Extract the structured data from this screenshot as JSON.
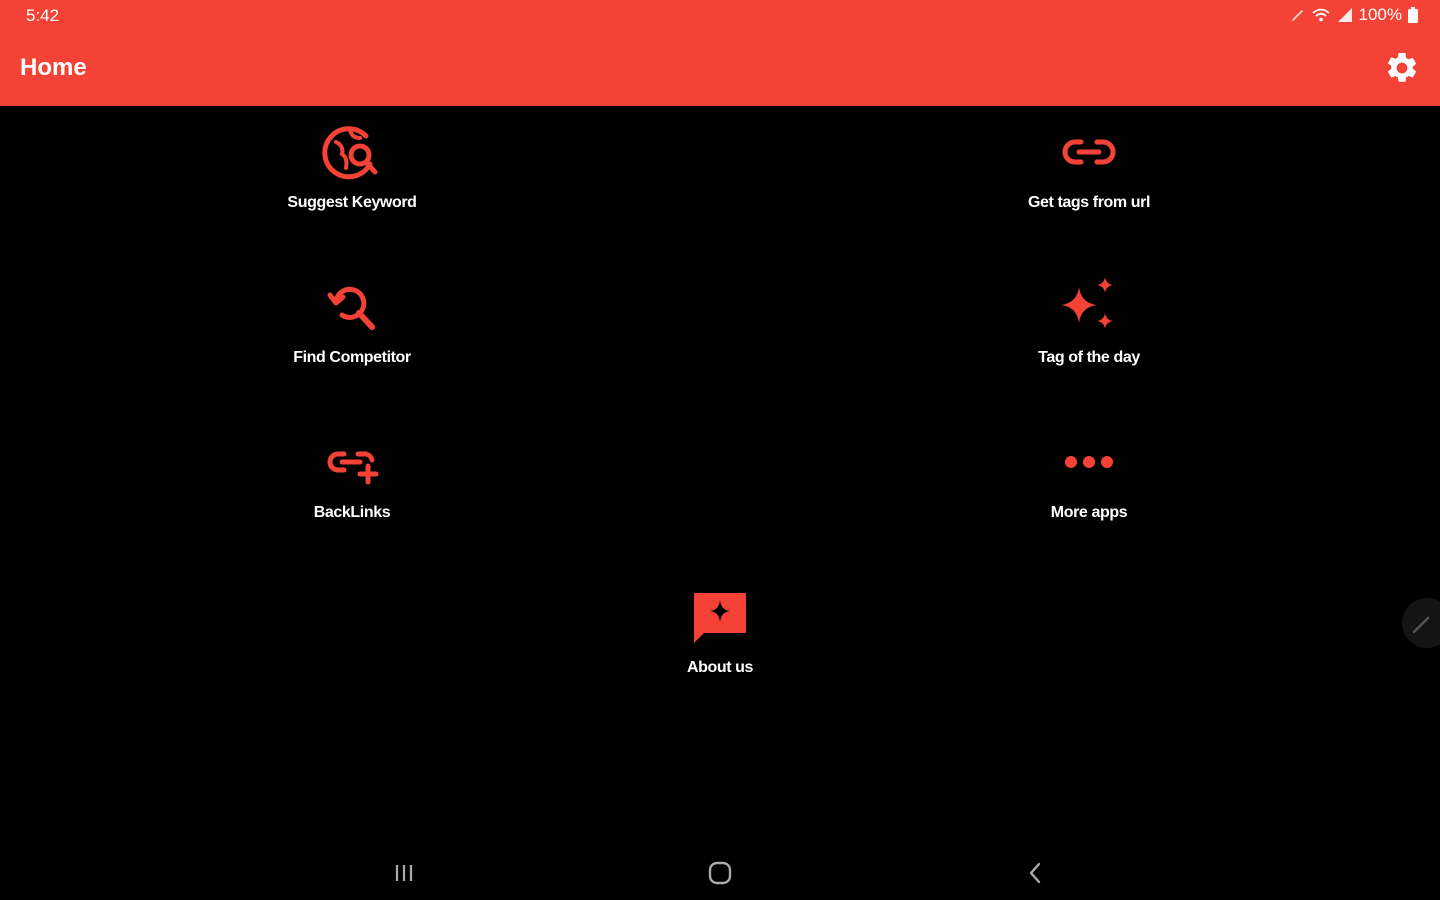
{
  "status_bar": {
    "time": "5:42",
    "battery": "100%",
    "icons": [
      "pen-icon",
      "wifi-icon",
      "signal-icon",
      "battery-icon"
    ]
  },
  "app_bar": {
    "title": "Home",
    "settings_icon": "gear-icon"
  },
  "menu": {
    "items": [
      {
        "label": "Suggest Keyword",
        "icon": "globe-search-icon"
      },
      {
        "label": "Get tags from url",
        "icon": "link-icon"
      },
      {
        "label": "Find Competitor",
        "icon": "search-refresh-icon"
      },
      {
        "label": "Tag of the day",
        "icon": "sparkle-icon"
      },
      {
        "label": "BackLinks",
        "icon": "link-add-icon"
      },
      {
        "label": "More apps",
        "icon": "more-dots-icon"
      },
      {
        "label": "About us",
        "icon": "chat-sparkle-icon"
      }
    ]
  },
  "nav_bar": {
    "buttons": [
      "recents-icon",
      "home-icon",
      "back-icon"
    ]
  },
  "colors": {
    "accent": "#F44336",
    "background": "#000000",
    "text": "#FFFFFF"
  }
}
